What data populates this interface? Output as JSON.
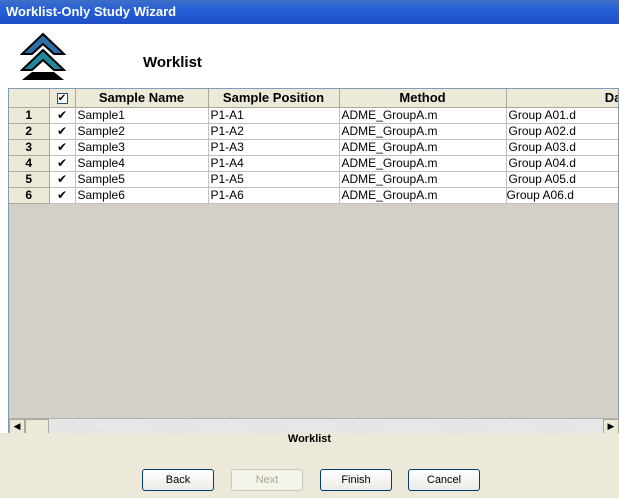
{
  "window": {
    "title": "Worklist-Only Study Wizard"
  },
  "header": {
    "title": "Worklist",
    "logo_icon": "double-up-arrow-icon"
  },
  "grid": {
    "columns": [
      "",
      "",
      "Sample Name",
      "Sample Position",
      "Method",
      "Data F"
    ],
    "header_check": "✔",
    "rows": [
      {
        "num": "1",
        "check": "✔",
        "name": "Sample1",
        "position": "P1-A1",
        "method": "ADME_GroupA.m",
        "data": "Group A01.d"
      },
      {
        "num": "2",
        "check": "✔",
        "name": "Sample2",
        "position": "P1-A2",
        "method": "ADME_GroupA.m",
        "data": "Group A02.d"
      },
      {
        "num": "3",
        "check": "✔",
        "name": "Sample3",
        "position": "P1-A3",
        "method": "ADME_GroupA.m",
        "data": "Group A03.d"
      },
      {
        "num": "4",
        "check": "✔",
        "name": "Sample4",
        "position": "P1-A4",
        "method": "ADME_GroupA.m",
        "data": "Group A04.d"
      },
      {
        "num": "5",
        "check": "✔",
        "name": "Sample5",
        "position": "P1-A5",
        "method": "ADME_GroupA.m",
        "data": "Group A05.d"
      },
      {
        "num": "6",
        "check": "✔",
        "name": "Sample6",
        "position": "P1-A6",
        "method": "ADME_GroupA.m",
        "data": "Group A06.d"
      }
    ],
    "caption": "Worklist"
  },
  "buttons": {
    "back": "Back",
    "next": "Next",
    "finish": "Finish",
    "cancel": "Cancel"
  },
  "colors": {
    "titlebar": "#245ed7",
    "panel": "#ece9d8",
    "empty_grid": "#d4d0c8"
  }
}
